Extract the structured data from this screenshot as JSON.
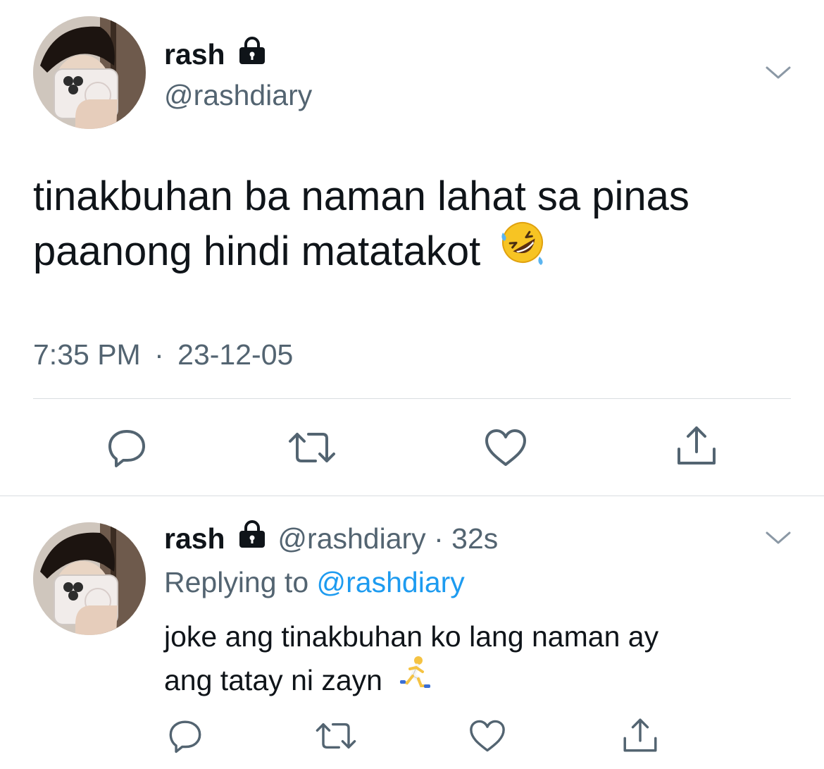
{
  "main_tweet": {
    "display_name": "rash",
    "handle": "@rashdiary",
    "text_line1": "tinakbuhan ba naman lahat sa pinas",
    "text_line2": "paanong hindi matatakot",
    "emoji": "rolling-on-floor-laughing",
    "time": "7:35 PM",
    "separator": "·",
    "date": "23-12-05",
    "menu_icon": "chevron-down-icon",
    "actions": [
      "reply-icon",
      "retweet-icon",
      "like-icon",
      "share-icon"
    ]
  },
  "reply_tweet": {
    "display_name": "rash",
    "handle": "@rashdiary",
    "separator": "·",
    "age": "32s",
    "replying_prefix": "Replying to",
    "replying_handle": "@rashdiary",
    "text_line1": "joke ang tinakbuhan ko lang naman ay",
    "text_line2": "ang tatay ni zayn",
    "emoji": "person-running",
    "menu_icon": "chevron-down-icon",
    "actions": [
      "reply-icon",
      "retweet-icon",
      "like-icon",
      "share-icon"
    ]
  },
  "colors": {
    "text": "#0f1419",
    "secondary": "#536471",
    "link": "#1d9bf0",
    "divider": "#d9dde1"
  }
}
